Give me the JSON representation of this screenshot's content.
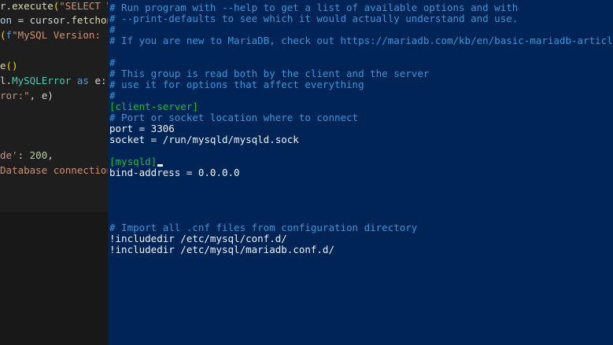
{
  "editor": {
    "lines": [
      {
        "parts": [
          {
            "t": "r.",
            "c": "c-default"
          },
          {
            "t": "execute",
            "c": "c-func"
          },
          {
            "t": "(",
            "c": "c-paren"
          },
          {
            "t": "\"SELECT V",
            "c": "c-str"
          }
        ]
      },
      {
        "parts": [
          {
            "t": "on ",
            "c": "c-var"
          },
          {
            "t": "= cursor.",
            "c": "c-default"
          },
          {
            "t": "fetchon",
            "c": "c-func"
          }
        ]
      },
      {
        "parts": [
          {
            "t": "(",
            "c": "c-paren"
          },
          {
            "t": "f",
            "c": "c-kw"
          },
          {
            "t": "\"MySQL Version: ",
            "c": "c-str"
          }
        ]
      },
      {
        "parts": [
          {
            "t": "e",
            "c": "c-func"
          },
          {
            "t": "()",
            "c": "c-paren"
          }
        ]
      },
      {
        "parts": [
          {
            "t": "l.",
            "c": "c-default"
          },
          {
            "t": "MySQLError",
            "c": "c-class"
          },
          {
            "t": " as ",
            "c": "c-kw"
          },
          {
            "t": "e:",
            "c": "c-default"
          }
        ]
      },
      {
        "parts": [
          {
            "t": "ror:\"",
            "c": "c-str"
          },
          {
            "t": ", e)",
            "c": "c-default"
          }
        ]
      },
      {
        "parts": [
          {
            "t": "de'",
            "c": "c-str"
          },
          {
            "t": ": ",
            "c": "c-default"
          },
          {
            "t": "200",
            "c": "c-num"
          },
          {
            "t": ",",
            "c": "c-default"
          }
        ]
      },
      {
        "parts": [
          {
            "t": "Database connection",
            "c": "c-str"
          }
        ]
      }
    ]
  },
  "terminal": {
    "lines": [
      {
        "text": "# Run program with --help to get a list of available options and with",
        "type": "t-comment"
      },
      {
        "text": "# --print-defaults to see which it would actually understand and use.",
        "type": "t-comment"
      },
      {
        "text": "#",
        "type": "t-comment"
      },
      {
        "text": "# If you are new to MariaDB, check out https://mariadb.com/kb/en/basic-mariadb-articles/",
        "type": "t-comment"
      },
      {
        "text": "#",
        "type": "t-comment"
      },
      {
        "text": "# This group is read both by the client and the server",
        "type": "t-comment"
      },
      {
        "text": "# use it for options that affect everything",
        "type": "t-comment"
      },
      {
        "text": "#",
        "type": "t-comment"
      },
      {
        "text": "[client-server]",
        "type": "t-section"
      },
      {
        "text": "# Port or socket location where to connect",
        "type": "t-comment"
      },
      {
        "text": "port = 3306",
        "type": "t-plain"
      },
      {
        "text": "socket = /run/mysqld/mysqld.sock",
        "type": "t-plain"
      },
      {
        "text": "[mysqld]",
        "type": "t-section"
      },
      {
        "text": "bind-address = 0.0.0.0",
        "type": "t-plain"
      },
      {
        "text": "# Import all .cnf files from configuration directory",
        "type": "t-comment"
      },
      {
        "text": "!includedir /etc/mysql/conf.d/",
        "type": "t-plain"
      },
      {
        "text": "!includedir /etc/mysql/mariadb.conf.d/",
        "type": "t-plain"
      }
    ]
  }
}
